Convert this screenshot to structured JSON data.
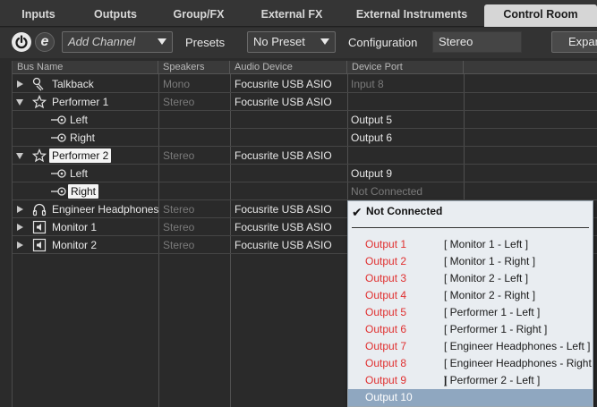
{
  "tabs": [
    {
      "label": "Inputs"
    },
    {
      "label": "Outputs"
    },
    {
      "label": "Group/FX"
    },
    {
      "label": "External FX"
    },
    {
      "label": "External Instruments"
    },
    {
      "label": "Control Room",
      "active": true
    }
  ],
  "toolbar": {
    "add_channel_placeholder": "Add Channel",
    "presets_label": "Presets",
    "preset_value": "No Preset",
    "configuration_label": "Configuration",
    "configuration_value": "Stereo",
    "expand_label": "Expan"
  },
  "columns": {
    "bus_name": "Bus Name",
    "speakers": "Speakers",
    "audio_device": "Audio Device",
    "device_port": "Device Port"
  },
  "rows": [
    {
      "name": "Talkback",
      "speakers": "Mono",
      "device": "Focusrite USB ASIO",
      "port": "Input 8",
      "icon": "microphone-icon"
    },
    {
      "name": "Performer 1",
      "speakers": "Stereo",
      "device": "Focusrite USB ASIO",
      "port": "",
      "icon": "star-icon"
    },
    {
      "name": "Left",
      "speakers": "",
      "device": "",
      "port": "Output 5",
      "icon": "speaker-channel-icon"
    },
    {
      "name": "Right",
      "speakers": "",
      "device": "",
      "port": "Output 6",
      "icon": "speaker-channel-icon"
    },
    {
      "name": "Performer 2",
      "speakers": "Stereo",
      "device": "Focusrite USB ASIO",
      "port": "",
      "icon": "star-icon"
    },
    {
      "name": "Left",
      "speakers": "",
      "device": "",
      "port": "Output 9",
      "icon": "speaker-channel-icon"
    },
    {
      "name": "Right",
      "speakers": "",
      "device": "",
      "port": "Not Connected",
      "icon": "speaker-channel-icon"
    },
    {
      "name": "Engineer Headphones",
      "speakers": "Stereo",
      "device": "Focusrite USB ASIO",
      "port": "",
      "icon": "headphones-icon"
    },
    {
      "name": "Monitor 1",
      "speakers": "Stereo",
      "device": "Focusrite USB ASIO",
      "port": "",
      "icon": "monitor-speaker-icon"
    },
    {
      "name": "Monitor 2",
      "speakers": "Stereo",
      "device": "Focusrite USB ASIO",
      "port": "",
      "icon": "monitor-speaker-icon"
    }
  ],
  "dropdown": {
    "header": "Not Connected",
    "items": [
      {
        "port": "Output 1",
        "conn": "[ Monitor 1 - Left ]"
      },
      {
        "port": "Output 2",
        "conn": "[ Monitor 1 - Right ]"
      },
      {
        "port": "Output 3",
        "conn": "[ Monitor 2 - Left ]"
      },
      {
        "port": "Output 4",
        "conn": "[ Monitor 2 - Right ]"
      },
      {
        "port": "Output 5",
        "conn": "[ Performer 1 - Left ]"
      },
      {
        "port": "Output 6",
        "conn": "[ Performer 1 - Right ]"
      },
      {
        "port": "Output 7",
        "conn": "[ Engineer Headphones - Left ]"
      },
      {
        "port": "Output 8",
        "conn": "[ Engineer Headphones - Right ]"
      },
      {
        "port": "Output 9",
        "conn": "[ Performer 2 - Left ]"
      },
      {
        "port": "Output 10",
        "conn": ""
      }
    ]
  }
}
